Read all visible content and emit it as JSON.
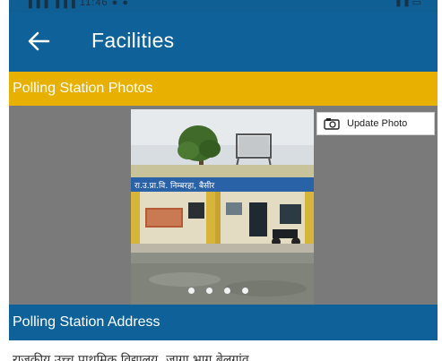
{
  "statusbar": {
    "left": "▐▐▐ ▐▐▐ 11:46 ● ●",
    "right": "▮ ▮ ▭"
  },
  "header": {
    "title": "Facilities",
    "back_icon": "arrow-left-icon"
  },
  "photos_section": {
    "title": "Polling Station Photos"
  },
  "gallery": {
    "update_label": "Update Photo",
    "update_icon": "camera-icon",
    "page_count": 4,
    "current_page": 1
  },
  "address_section": {
    "title": "Polling Station Address"
  },
  "address": {
    "text": "राजकीय उच्च प्राथमिक विद्यालय, जागा भाग बेलगांव"
  },
  "colors": {
    "primary": "#0f6299",
    "accent": "#e8b000",
    "gallery_bg": "#7a7a7a"
  }
}
